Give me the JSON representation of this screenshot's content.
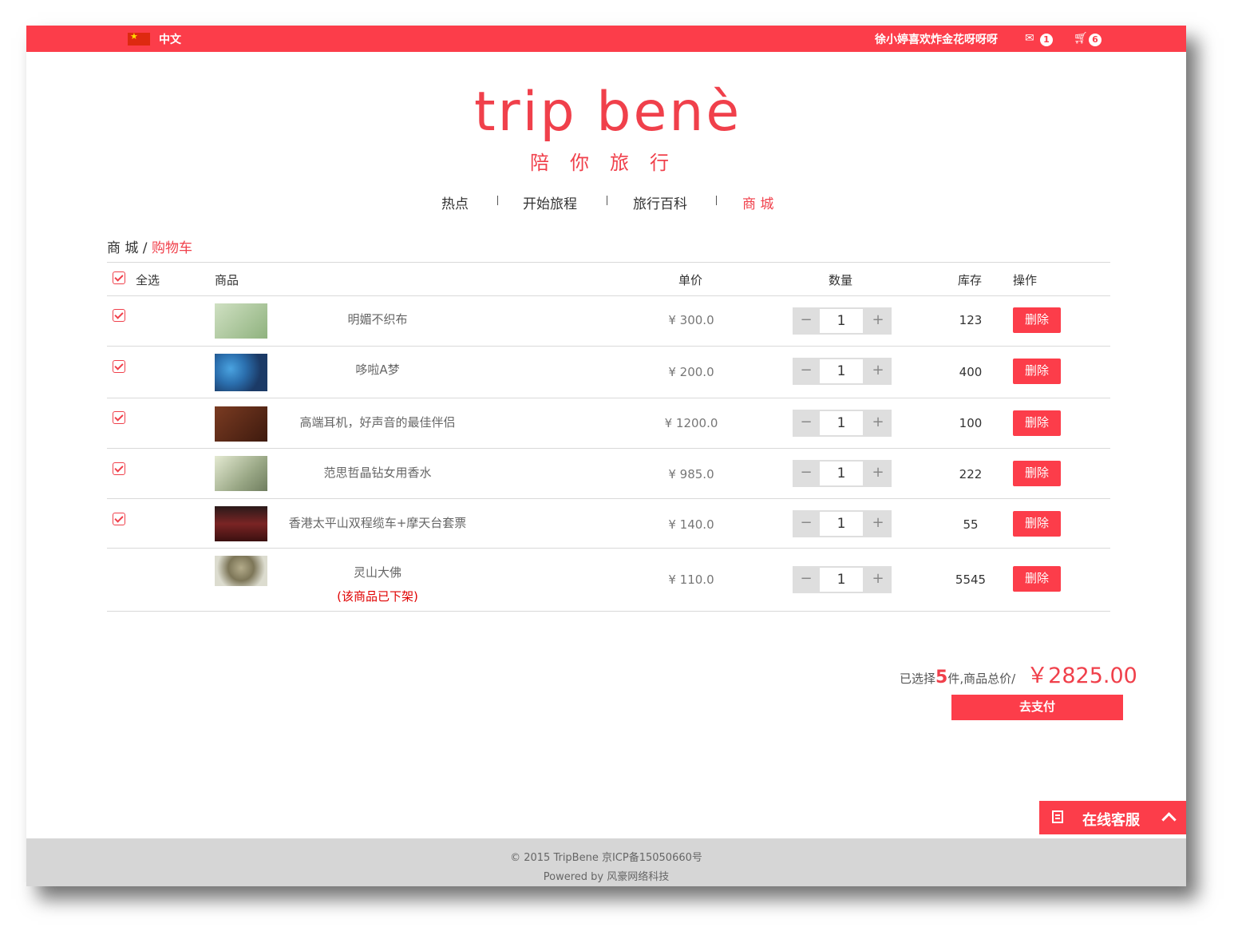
{
  "topbar": {
    "language": "中文",
    "username": "徐小婷喜欢炸金花呀呀呀",
    "message_count": "1",
    "cart_count": "6",
    "accent_color": "#fc3d4a"
  },
  "logo": {
    "text": "trip benè",
    "subtitle": "陪你旅行"
  },
  "nav": {
    "items": [
      "热点",
      "开始旅程",
      "旅行百科",
      "商 城"
    ],
    "active_index": 3
  },
  "breadcrumb": {
    "parent": "商 城 /",
    "current": "购物车"
  },
  "table": {
    "headers": {
      "select_all": "全选",
      "product": "商品",
      "unit_price": "单价",
      "quantity": "数量",
      "stock": "库存",
      "action": "操作"
    },
    "rows": [
      {
        "checked": true,
        "name": "明媚不织布",
        "note": "",
        "price": "¥ 300.0",
        "qty": "1",
        "stock": "123",
        "delete_label": "删除",
        "thumb_color": "#a9c79a"
      },
      {
        "checked": true,
        "name": "哆啦A梦",
        "note": "",
        "price": "¥ 200.0",
        "qty": "1",
        "stock": "400",
        "delete_label": "删除",
        "thumb_color": "#2f73b3"
      },
      {
        "checked": true,
        "name": "高端耳机，好声音的最佳伴侣",
        "note": "",
        "price": "¥ 1200.0",
        "qty": "1",
        "stock": "100",
        "delete_label": "删除",
        "thumb_color": "#5a2a1a"
      },
      {
        "checked": true,
        "name": "范思哲晶钻女用香水",
        "note": "",
        "price": "¥ 985.0",
        "qty": "1",
        "stock": "222",
        "delete_label": "删除",
        "thumb_color": "#b9c4a2"
      },
      {
        "checked": true,
        "name": "香港太平山双程缆车+摩天台套票",
        "note": "",
        "price": "¥ 140.0",
        "qty": "1",
        "stock": "55",
        "delete_label": "删除",
        "thumb_color": "#5a1d1d"
      },
      {
        "checked": false,
        "name": "灵山大佛",
        "note": "(该商品已下架)",
        "price": "¥ 110.0",
        "qty": "1",
        "stock": "5545",
        "delete_label": "删除",
        "thumb_color": "#8d8a70"
      }
    ]
  },
  "summary": {
    "prefix": "已选择",
    "count": "5",
    "middle": "件,商品总价/",
    "total": "￥2825.00",
    "pay_label": "去支付"
  },
  "service": {
    "label": "在线客服"
  },
  "footer": {
    "line1": "© 2015 TripBene 京ICP备15050660号",
    "line2": "Powered by 风豪网络科技"
  }
}
